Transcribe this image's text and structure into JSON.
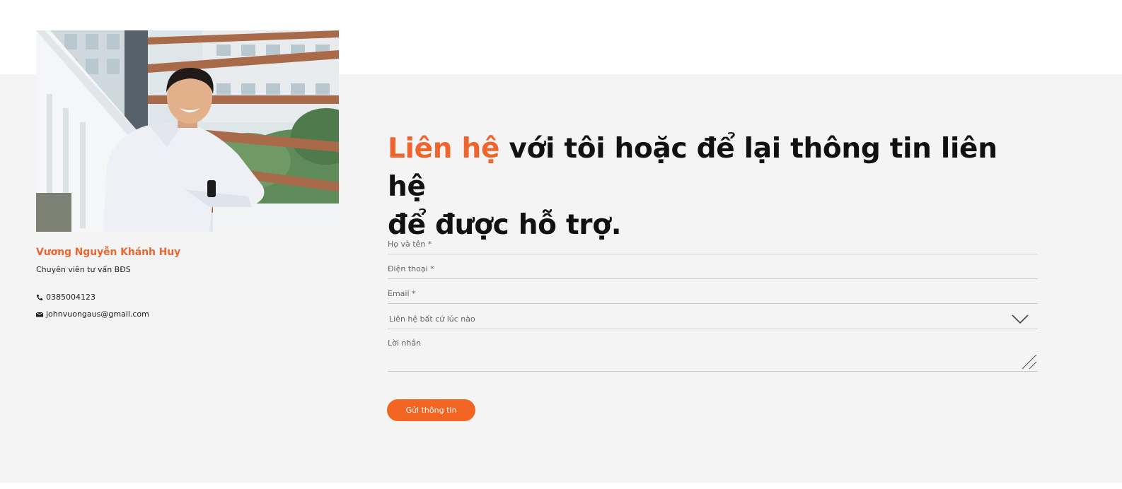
{
  "agent": {
    "photo_alt": "agent-portrait",
    "name": "Vương Nguyễn Khánh Huy",
    "title": "Chuyên viên tư vấn BĐS",
    "phone": "0385004123",
    "email": "johnvuongaus@gmail.com",
    "phone_icon": "phone-icon",
    "email_icon": "envelope-icon"
  },
  "heading": {
    "accent": "Liên hệ",
    "rest_line1": " với tôi hoặc để lại thông tin liên hệ",
    "line2": "để được hỗ trợ."
  },
  "form": {
    "name_label": "Họ và tên *",
    "phone_label": "Điện thoại *",
    "email_label": "Email *",
    "time_selected": "Liên hệ bất cứ lúc nào",
    "message_label": "Lời nhắn",
    "submit_label": "Gửi thông tin"
  },
  "colors": {
    "accent": "#f0652e",
    "button": "#f26522",
    "band": "#f3f4f3"
  }
}
